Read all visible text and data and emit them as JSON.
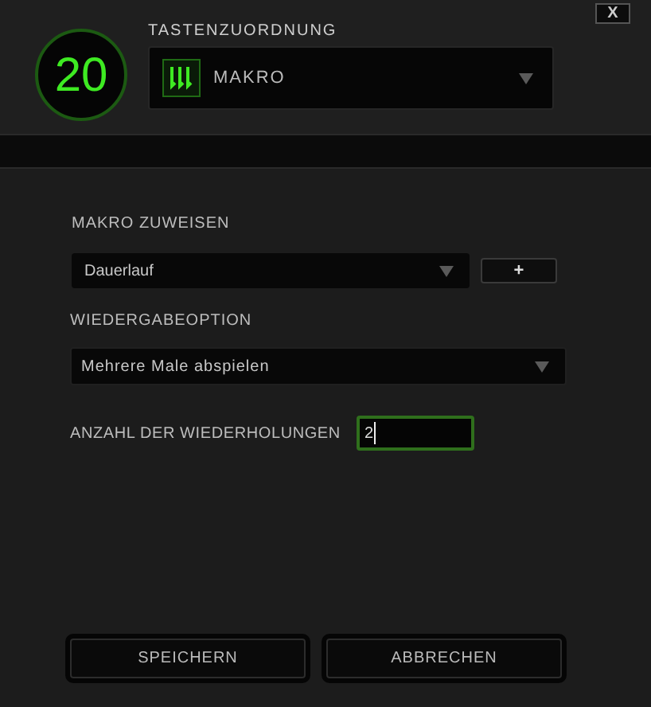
{
  "close_button": "X",
  "badge": "20",
  "key_assignment": {
    "label": "TASTENZUORDNUNG",
    "value": "MAKRO"
  },
  "assign_macro": {
    "label": "MAKRO ZUWEISEN",
    "value": "Dauerlauf",
    "add_button": "+"
  },
  "playback_option": {
    "label": "WIEDERGABEOPTION",
    "value": "Mehrere Male abspielen"
  },
  "repeat_count": {
    "label": "ANZAHL DER WIEDERHOLUNGEN",
    "value": "2",
    "focused": true
  },
  "buttons": [
    "SPEICHERN",
    "ABBRECHEN"
  ]
}
